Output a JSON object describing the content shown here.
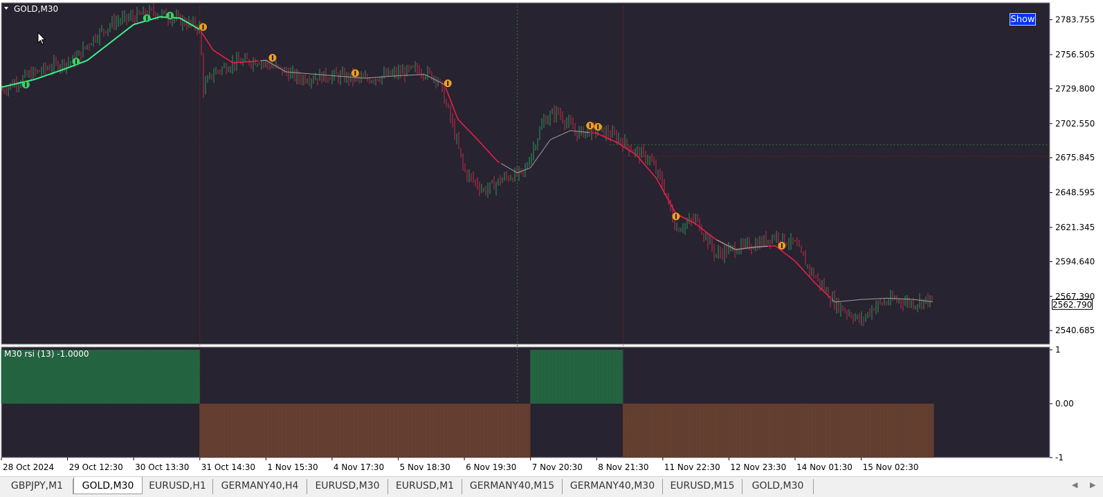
{
  "window": {
    "symbol_label": "GOLD,M30",
    "show_button": "Show",
    "current_price": "2562.790"
  },
  "price_axis": {
    "ticks": [
      "2783.755",
      "2756.505",
      "2729.800",
      "2702.550",
      "2675.845",
      "2648.595",
      "2621.345",
      "2594.640",
      "2567.390",
      "2540.685"
    ],
    "tick_values": [
      2783.755,
      2756.505,
      2729.8,
      2702.55,
      2675.845,
      2648.595,
      2621.345,
      2594.64,
      2567.39,
      2540.685
    ]
  },
  "indicator": {
    "label": "M30 rsi  (13) -1.0000",
    "axis_ticks": [
      "1",
      "0.00",
      "-1"
    ],
    "segments": [
      {
        "from_bar": 0,
        "to_bar": 3,
        "value": 1
      },
      {
        "from_bar": 3,
        "to_bar": 8,
        "value": -1
      },
      {
        "from_bar": 8,
        "to_bar": 9.4,
        "value": 1
      },
      {
        "from_bar": 9.4,
        "to_bar": 14.1,
        "value": -1
      }
    ]
  },
  "time_axis": {
    "labels": [
      "28 Oct 2024",
      "29 Oct 12:30",
      "30 Oct 13:30",
      "31 Oct 14:30",
      "1 Nov 15:30",
      "4 Nov 17:30",
      "5 Nov 18:30",
      "6 Nov 19:30",
      "7 Nov 20:30",
      "8 Nov 21:30",
      "11 Nov 22:30",
      "12 Nov 23:30",
      "14 Nov 01:30",
      "15 Nov 02:30"
    ]
  },
  "tabs": [
    {
      "label": "GBPJPY,M1",
      "active": false
    },
    {
      "label": "GOLD,M30",
      "active": true
    },
    {
      "label": "EURUSD,H1",
      "active": false
    },
    {
      "label": "GERMANY40,H4",
      "active": false
    },
    {
      "label": "EURUSD,M30",
      "active": false
    },
    {
      "label": "EURUSD,M1",
      "active": false
    },
    {
      "label": "GERMANY40,M15",
      "active": false
    },
    {
      "label": "GERMANY40,M30",
      "active": false
    },
    {
      "label": "EURUSD,M15",
      "active": false
    },
    {
      "label": "GOLD,M30",
      "active": false
    }
  ],
  "chart_data": {
    "type": "line",
    "price_path": {
      "x_bars": [
        0,
        0.4,
        0.8,
        1.1,
        1.4,
        1.7,
        2.0,
        2.3,
        2.6,
        3.0,
        3.05,
        3.2,
        3.5,
        3.9,
        4.2,
        4.5,
        5.0,
        5.5,
        6.0,
        6.3,
        6.6,
        6.8,
        7.0,
        7.3,
        7.6,
        7.9,
        8.2,
        8.4,
        8.7,
        9.0,
        9.3,
        9.6,
        9.8,
        10.0,
        10.2,
        10.5,
        10.8,
        11.1,
        11.4,
        11.7,
        12.0,
        12.2,
        12.6,
        13.0,
        13.2,
        13.5,
        13.8,
        14.0,
        14.1
      ],
      "prices": [
        2729,
        2740,
        2748,
        2752,
        2770,
        2782,
        2786,
        2790,
        2785,
        2778,
        2730,
        2742,
        2750,
        2752,
        2745,
        2738,
        2740,
        2737,
        2742,
        2745,
        2738,
        2705,
        2665,
        2650,
        2660,
        2664,
        2705,
        2712,
        2695,
        2698,
        2692,
        2680,
        2675,
        2655,
        2620,
        2628,
        2600,
        2605,
        2608,
        2615,
        2608,
        2590,
        2562,
        2548,
        2560,
        2565,
        2562,
        2565,
        2562.79
      ]
    },
    "moving_average": {
      "x_bars": [
        0,
        0.5,
        1.0,
        1.3,
        1.7,
        2.0,
        2.4,
        2.7,
        3.0,
        3.2,
        3.5,
        4.0,
        4.3,
        5.0,
        5.5,
        6.0,
        6.4,
        6.7,
        6.9,
        7.2,
        7.5,
        7.8,
        8.0,
        8.3,
        8.6,
        9.0,
        9.3,
        9.6,
        9.9,
        10.2,
        10.5,
        10.8,
        11.1,
        11.4,
        11.7,
        12.0,
        12.3,
        12.6,
        13.0,
        13.4,
        13.8,
        14.1
      ],
      "prices": [
        2731,
        2737,
        2746,
        2752,
        2768,
        2780,
        2786,
        2785,
        2776,
        2760,
        2750,
        2752,
        2743,
        2740,
        2738,
        2740,
        2741,
        2733,
        2706,
        2690,
        2673,
        2664,
        2668,
        2690,
        2697,
        2695,
        2688,
        2678,
        2660,
        2632,
        2624,
        2612,
        2604,
        2606,
        2607,
        2595,
        2578,
        2563,
        2565,
        2566,
        2565,
        2563
      ]
    },
    "signals": [
      {
        "x_bar": 0.37,
        "price": 2733,
        "dir": "up"
      },
      {
        "x_bar": 1.13,
        "price": 2751,
        "dir": "up"
      },
      {
        "x_bar": 2.2,
        "price": 2785,
        "dir": "up"
      },
      {
        "x_bar": 2.55,
        "price": 2787,
        "dir": "up"
      },
      {
        "x_bar": 3.05,
        "price": 2778,
        "dir": "down"
      },
      {
        "x_bar": 4.1,
        "price": 2754,
        "dir": "down"
      },
      {
        "x_bar": 5.35,
        "price": 2742,
        "dir": "down"
      },
      {
        "x_bar": 6.75,
        "price": 2734,
        "dir": "down"
      },
      {
        "x_bar": 8.9,
        "price": 2701,
        "dir": "down"
      },
      {
        "x_bar": 9.02,
        "price": 2700,
        "dir": "down"
      },
      {
        "x_bar": 10.2,
        "price": 2630,
        "dir": "down"
      },
      {
        "x_bar": 11.8,
        "price": 2607,
        "dir": "down"
      }
    ],
    "ylim": [
      2530,
      2797
    ],
    "xlim": [
      0,
      15.85
    ],
    "price_line": 2677,
    "crosshair_price": 2686,
    "crosshair_bar": 7.8
  }
}
